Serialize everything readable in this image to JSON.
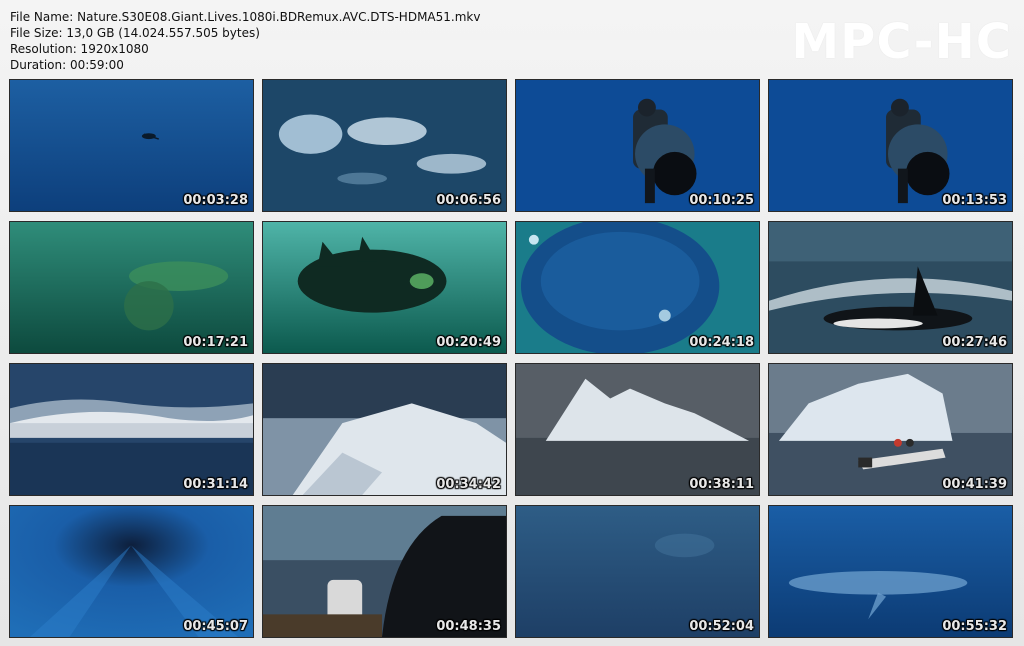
{
  "info": {
    "file_name": "File Name: Nature.S30E08.Giant.Lives.1080i.BDRemux.AVC.DTS-HDMA51.mkv",
    "file_size": "File Size: 13,0 GB (14.024.557.505 bytes)",
    "resolution": "Resolution: 1920x1080",
    "duration": "Duration: 00:59:00"
  },
  "logo": "MPC-HC",
  "thumbnails": [
    {
      "time": "00:03:28",
      "scene": "diver-in-open-ocean"
    },
    {
      "time": "00:06:56",
      "scene": "whale-splash-aerial"
    },
    {
      "time": "00:10:25",
      "scene": "diver-with-camera"
    },
    {
      "time": "00:13:53",
      "scene": "diver-with-camera"
    },
    {
      "time": "00:17:21",
      "scene": "right-whale-green-water"
    },
    {
      "time": "00:20:49",
      "scene": "whale-from-below"
    },
    {
      "time": "00:24:18",
      "scene": "whale-closeup"
    },
    {
      "time": "00:27:46",
      "scene": "orca-surfacing"
    },
    {
      "time": "00:31:14",
      "scene": "ocean-wave"
    },
    {
      "time": "00:34:42",
      "scene": "iceberg-closeup"
    },
    {
      "time": "00:38:11",
      "scene": "iceberg-grey-sea"
    },
    {
      "time": "00:41:39",
      "scene": "boat-near-iceberg"
    },
    {
      "time": "00:45:07",
      "scene": "underwater-light-rays"
    },
    {
      "time": "00:48:35",
      "scene": "diver-on-boat"
    },
    {
      "time": "00:52:04",
      "scene": "faint-whale-deep-blue"
    },
    {
      "time": "00:55:32",
      "scene": "blue-whale-underwater"
    }
  ]
}
